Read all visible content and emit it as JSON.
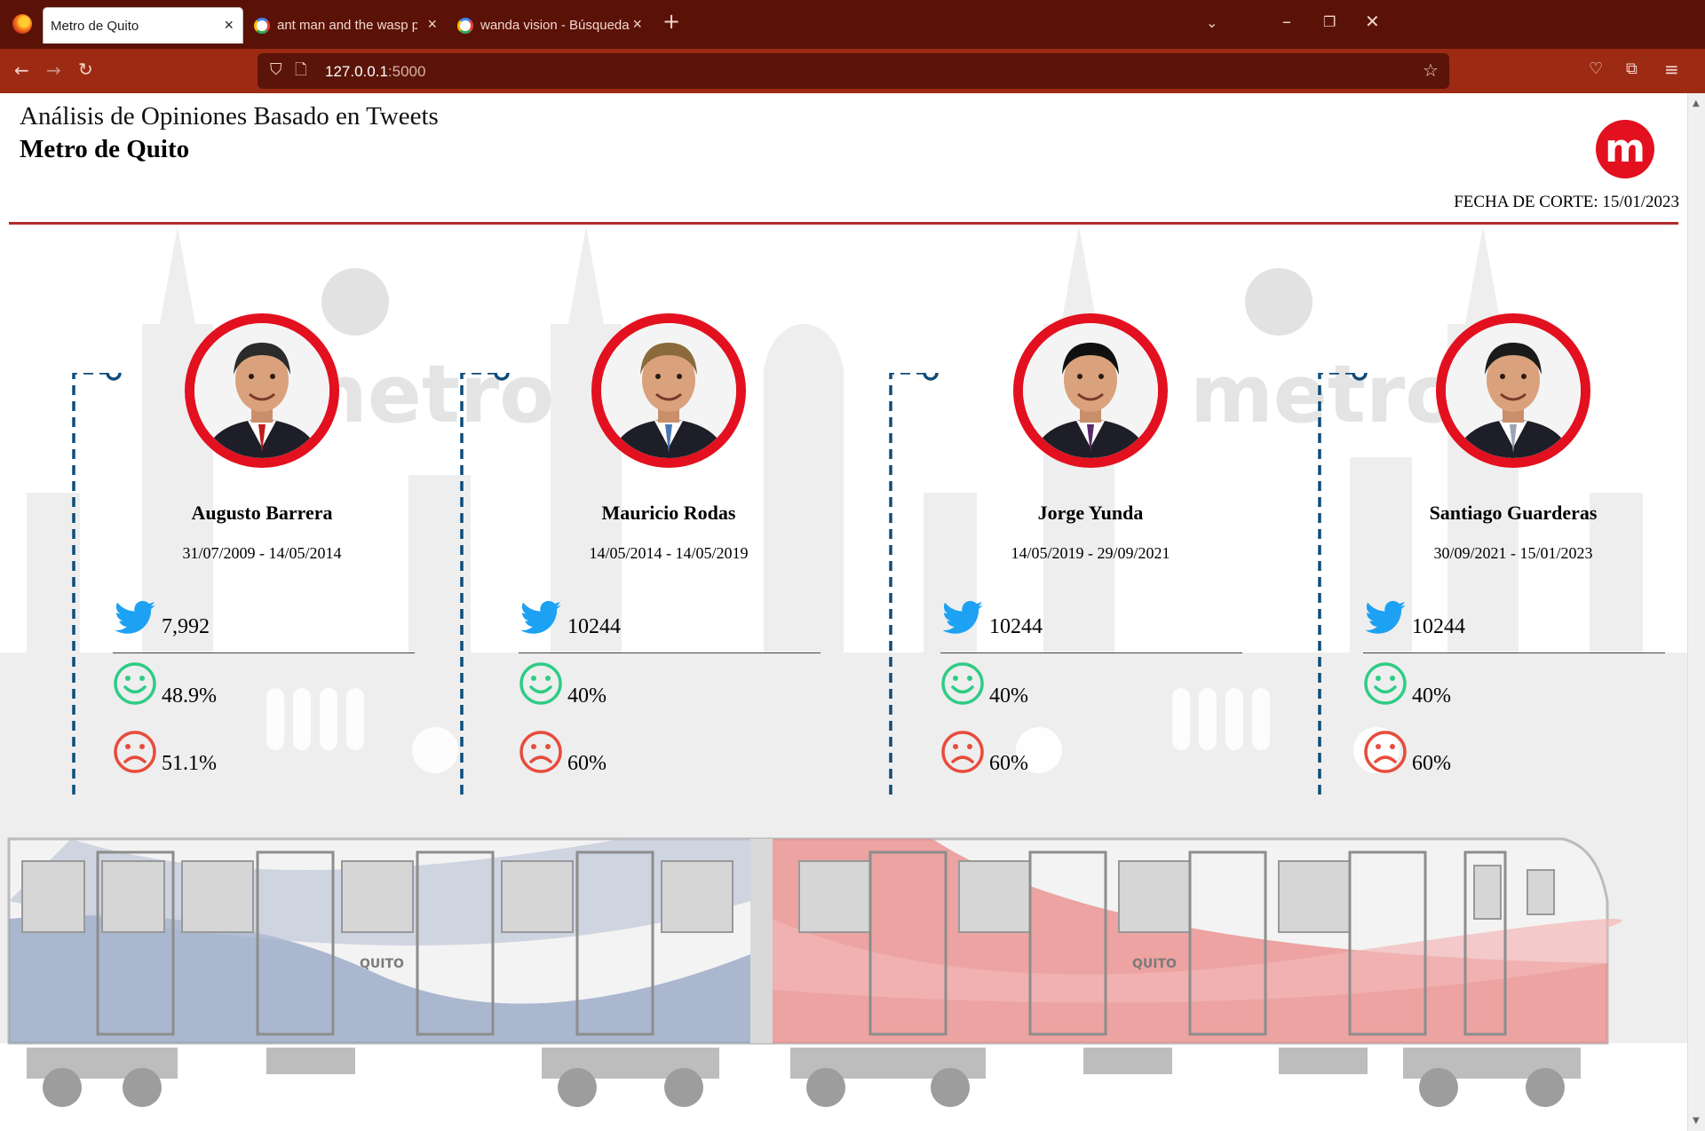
{
  "browser": {
    "tabs": [
      {
        "title": "Metro de Quito",
        "active": true
      },
      {
        "title": "ant man and the wasp police - B",
        "active": false
      },
      {
        "title": "wanda vision - Búsqueda de Go",
        "active": false
      }
    ],
    "url_host": "127.0.0.1",
    "url_port": ":5000"
  },
  "header": {
    "subtitle": "Análisis de Opiniones Basado en Tweets",
    "title": "Metro de Quito",
    "logo_letter": "m",
    "fecha": "FECHA DE CORTE: 15/01/2023"
  },
  "colors": {
    "accent_red": "#e3101f",
    "rule": "#b22a2a",
    "twitter_blue": "#1da1f2",
    "positive_green": "#2ecc85",
    "negative_red": "#e74c3c",
    "timeline_blue": "#0f4c7a"
  },
  "mayors": [
    {
      "name": "Augusto Barrera",
      "period": "31/07/2009 - 14/05/2014",
      "tweets": "7,992",
      "positive": "48.9%",
      "negative": "51.1%",
      "positive_value": 48.9,
      "negative_value": 51.1
    },
    {
      "name": "Mauricio Rodas",
      "period": "14/05/2014 - 14/05/2019",
      "tweets": "10244",
      "positive": "40%",
      "negative": "60%",
      "positive_value": 40,
      "negative_value": 60
    },
    {
      "name": "Jorge Yunda",
      "period": "14/05/2019 - 29/09/2021",
      "tweets": "10244",
      "positive": "40%",
      "negative": "60%",
      "positive_value": 40,
      "negative_value": 60
    },
    {
      "name": "Santiago Guarderas",
      "period": "30/09/2021 - 15/01/2023",
      "tweets": "10244",
      "positive": "40%",
      "negative": "60%",
      "positive_value": 40,
      "negative_value": 60
    }
  ],
  "icons": [
    "twitter-icon",
    "smile-icon",
    "frown-icon",
    "train-illustration",
    "cathedral-silhouette"
  ]
}
